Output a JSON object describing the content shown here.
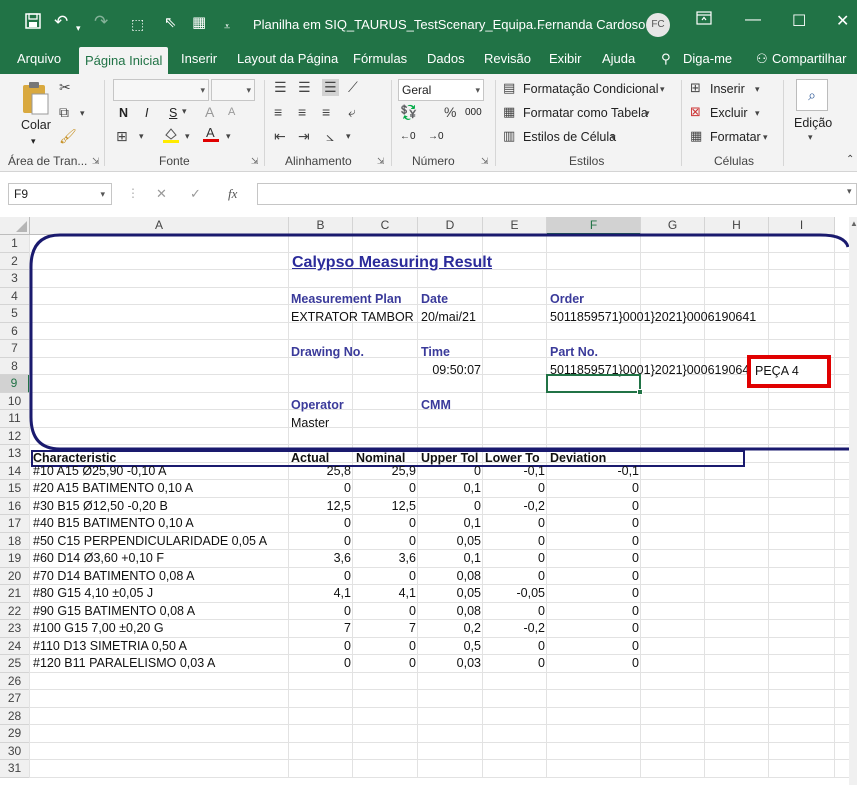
{
  "titlebar": {
    "doc_title": "Planilha em SIQ_TAURUS_TestScenary_Equipa...",
    "user_name": "Fernanda Cardoso",
    "user_initials": "FC"
  },
  "menu": {
    "tabs": [
      "Arquivo",
      "Página Inicial",
      "Inserir",
      "Layout da Página",
      "Fórmulas",
      "Dados",
      "Revisão",
      "Exibir",
      "Ajuda",
      "Diga-me",
      "Compartilhar"
    ]
  },
  "ribbon": {
    "clipboard": {
      "paste_label": "Colar",
      "group_label": "Área de Tran..."
    },
    "font": {
      "bold": "N",
      "italic": "I",
      "underline": "S",
      "group_label": "Fonte"
    },
    "alignment": {
      "group_label": "Alinhamento"
    },
    "number": {
      "format_value": "Geral",
      "group_label": "Número"
    },
    "styles": {
      "conditional": "Formatação Condicional",
      "as_table": "Formatar como Tabela",
      "cell_styles": "Estilos de Célula",
      "group_label": "Estilos"
    },
    "cells": {
      "insert": "Inserir",
      "delete": "Excluir",
      "format": "Formatar",
      "group_label": "Células"
    },
    "editing": {
      "label": "Edição"
    }
  },
  "formula_bar": {
    "name_box": "F9",
    "content": ""
  },
  "sheet": {
    "columns": [
      "A",
      "B",
      "C",
      "D",
      "E",
      "F",
      "G",
      "H",
      "I"
    ],
    "row_numbers": [
      "1",
      "2",
      "3",
      "4",
      "5",
      "6",
      "7",
      "8",
      "9",
      "10",
      "11",
      "12",
      "13",
      "14",
      "15",
      "16",
      "17",
      "18",
      "19",
      "20",
      "21",
      "22",
      "23",
      "24",
      "25",
      "26",
      "27",
      "28",
      "29",
      "30",
      "31"
    ],
    "header_block": {
      "title": "Calypso Measuring Result",
      "measurement_plan_label": "Measurement Plan",
      "measurement_plan_value": "EXTRATOR TAMBOR",
      "date_label": "Date",
      "date_value": "20/mai/21",
      "order_label": "Order",
      "order_value": "5011859571}0001}2021}0006190641",
      "drawing_label": "Drawing No.",
      "time_label": "Time",
      "time_value": "09:50:07",
      "part_label": "Part No.",
      "part_value": "5011859571}0001}2021}0006190641",
      "part_annotation": "PEÇA 4",
      "operator_label": "Operator",
      "operator_value": "Master",
      "cmm_label": "CMM"
    },
    "table_headers": [
      "Characteristic",
      "Actual",
      "Nominal",
      "Upper Tol",
      "Lower To",
      "Deviation"
    ],
    "table_rows": [
      [
        "#10  A15  Ø25,90 -0,10  A",
        "25,8",
        "25,9",
        "0",
        "-0,1",
        "-0,1"
      ],
      [
        "#20  A15  BATIMENTO  0,10  A",
        "0",
        "0",
        "0,1",
        "0",
        "0"
      ],
      [
        "#30  B15  Ø12,50 -0,20  B",
        "12,5",
        "12,5",
        "0",
        "-0,2",
        "0"
      ],
      [
        "#40  B15  BATIMENTO  0,10  A",
        "0",
        "0",
        "0,1",
        "0",
        "0"
      ],
      [
        "#50  C15  PERPENDICULARIDADE  0,05  A",
        "0",
        "0",
        "0,05",
        "0",
        "0"
      ],
      [
        "#60  D14  Ø3,60 +0,10  F",
        "3,6",
        "3,6",
        "0,1",
        "0",
        "0"
      ],
      [
        "#70  D14  BATIMENTO  0,08  A",
        "0",
        "0",
        "0,08",
        "0",
        "0"
      ],
      [
        "#80  G15  4,10 ±0,05  J",
        "4,1",
        "4,1",
        "0,05",
        "-0,05",
        "0"
      ],
      [
        "#90  G15  BATIMENTO  0,08  A",
        "0",
        "0",
        "0,08",
        "0",
        "0"
      ],
      [
        "#100  G15  7,00 ±0,20  G",
        "7",
        "7",
        "0,2",
        "-0,2",
        "0"
      ],
      [
        "#110  D13  SIMETRIA  0,50  A",
        "0",
        "0",
        "0,5",
        "0",
        "0"
      ],
      [
        "#120  B11  PARALELISMO  0,03  A",
        "0",
        "0",
        "0,03",
        "0",
        "0"
      ]
    ]
  },
  "colors": {
    "excel_green": "#217346",
    "header_blue": "#3a3a9a",
    "frame_navy": "#1a1a6e",
    "highlight_red": "#e00000"
  }
}
